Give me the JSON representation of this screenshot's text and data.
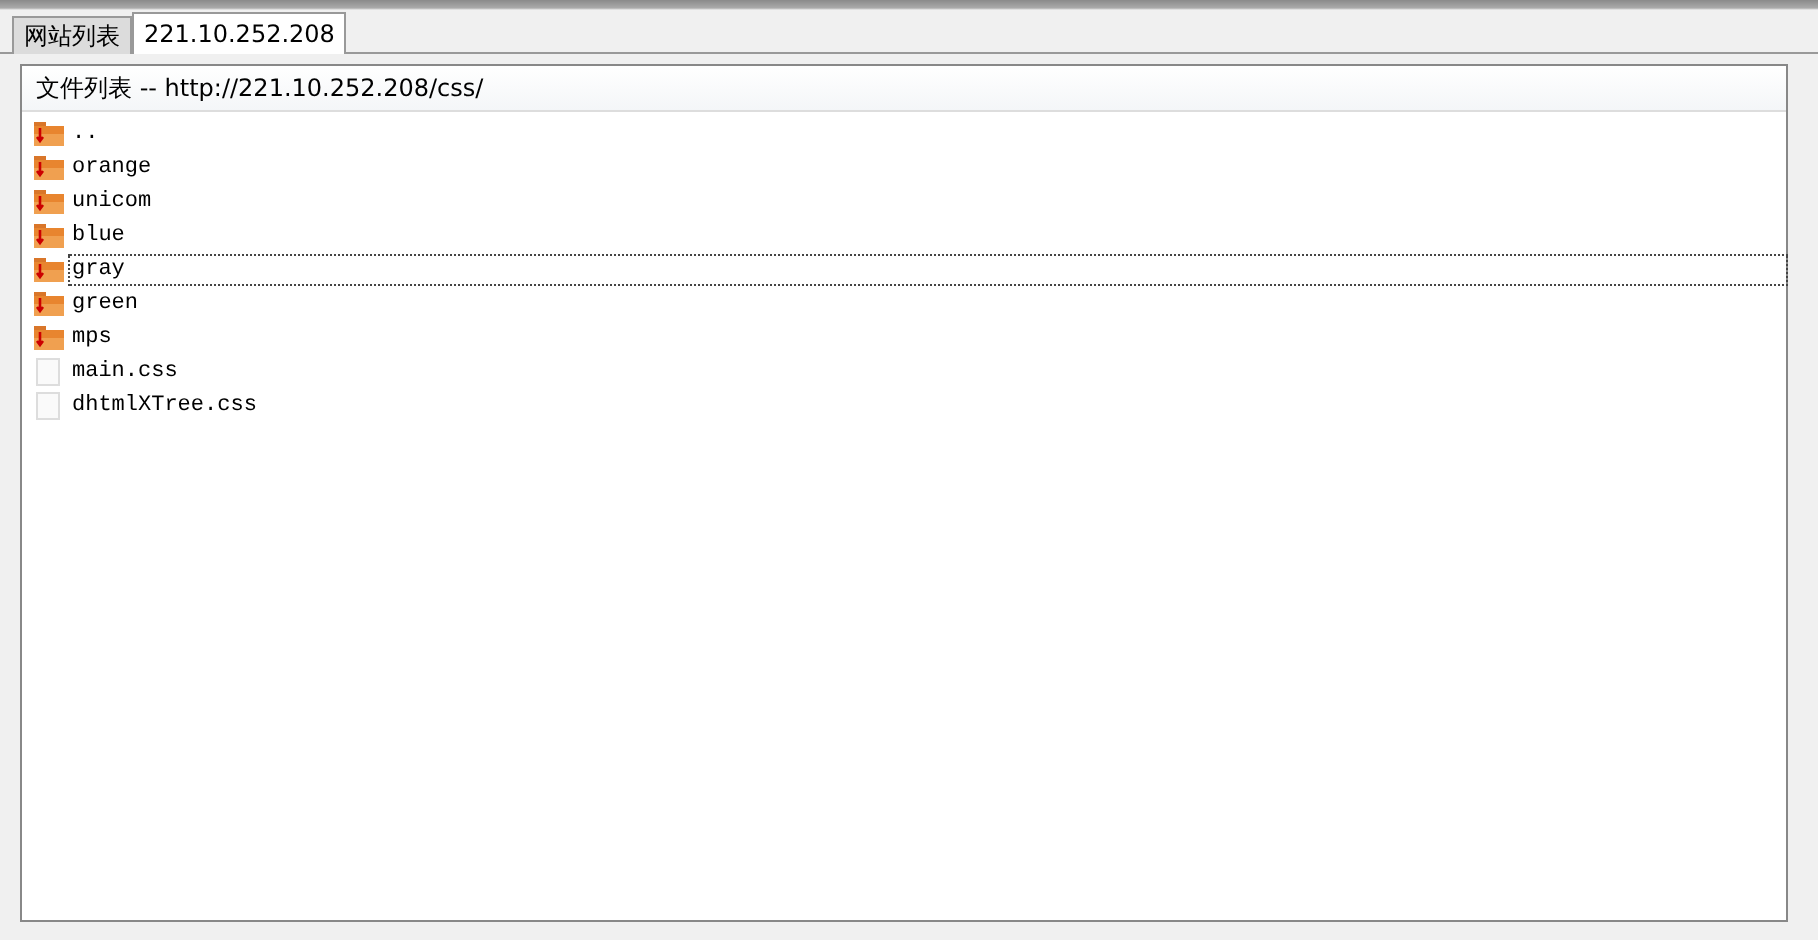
{
  "tabs": [
    {
      "label": "网站列表",
      "selected": false
    },
    {
      "label": "221.10.252.208",
      "selected": true
    }
  ],
  "file_list": {
    "header": "文件列表 -- http://221.10.252.208/css/",
    "items": [
      {
        "kind": "folder",
        "name": "..",
        "selected": false
      },
      {
        "kind": "folder",
        "name": "orange",
        "selected": false
      },
      {
        "kind": "folder",
        "name": "unicom",
        "selected": false
      },
      {
        "kind": "folder",
        "name": "blue",
        "selected": false
      },
      {
        "kind": "folder",
        "name": "gray",
        "selected": true
      },
      {
        "kind": "folder",
        "name": "green",
        "selected": false
      },
      {
        "kind": "folder",
        "name": "mps",
        "selected": false
      },
      {
        "kind": "file",
        "name": "main.css",
        "selected": false
      },
      {
        "kind": "file",
        "name": "dhtmlXTree.css",
        "selected": false
      }
    ]
  }
}
